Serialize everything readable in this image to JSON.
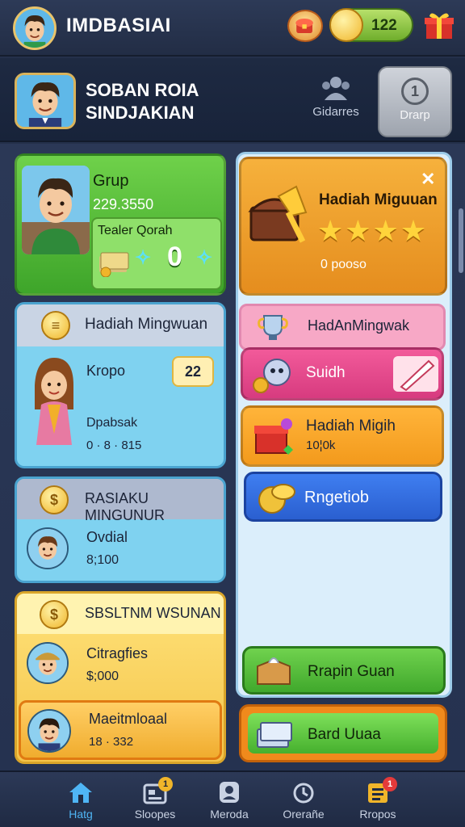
{
  "topbar": {
    "title": "IMDBASIAI",
    "coins": "122"
  },
  "profile": {
    "name_line1": "SOBAN ROIA",
    "name_line2": "SINDJAKIAN",
    "clan_label": "Gidarres",
    "group_button_number": "1",
    "group_button_label": "Drarp"
  },
  "group_card": {
    "title": "Grup",
    "value": "229.3550",
    "badge_label": "Tealer Qorah",
    "badge_big": "0"
  },
  "reward_card": {
    "title": "Hadiah Miguuan",
    "footer": "0 pooso",
    "stars": "★★★★"
  },
  "weekly_card": {
    "header": "Hadiah Mingwuan",
    "name": "Kropo",
    "pill_value": "22",
    "subtitle": "Dpabsak",
    "resources": "0  ·  8  ·  815"
  },
  "right_list": {
    "pink_header": "HadAnMingwak",
    "magenta_title": "Suidh",
    "amber_title": "Hadiah Migih",
    "amber_sub": "10¦0k",
    "blue_button": "Rngetiob"
  },
  "slate_card": {
    "header": "RASIAKU MINGUNUR",
    "row_title": "Ovdial",
    "row_value": "8;100"
  },
  "yellow_card": {
    "header": "SBSLTNM WSUNAN",
    "row_title": "Citragfies",
    "row_value": "$;000",
    "sub_title": "Maeitmloaal",
    "sub_value": "18  ·  332"
  },
  "buttons": {
    "green": "Rrapin Guan",
    "orange": "Bard Uuaa"
  },
  "bottom_nav": [
    {
      "label": "Hatg"
    },
    {
      "label": "Sloopes",
      "badge": "1"
    },
    {
      "label": "Meroda"
    },
    {
      "label": "Orerañe"
    },
    {
      "label": "Rropos",
      "badge": "1"
    }
  ],
  "colors": {
    "background": "#24304a",
    "accent_blue": "#4fb5f5",
    "green": "#3ea52a",
    "orange": "#e58d1e",
    "pink": "#f7a8c6",
    "magenta": "#d73b7f"
  }
}
